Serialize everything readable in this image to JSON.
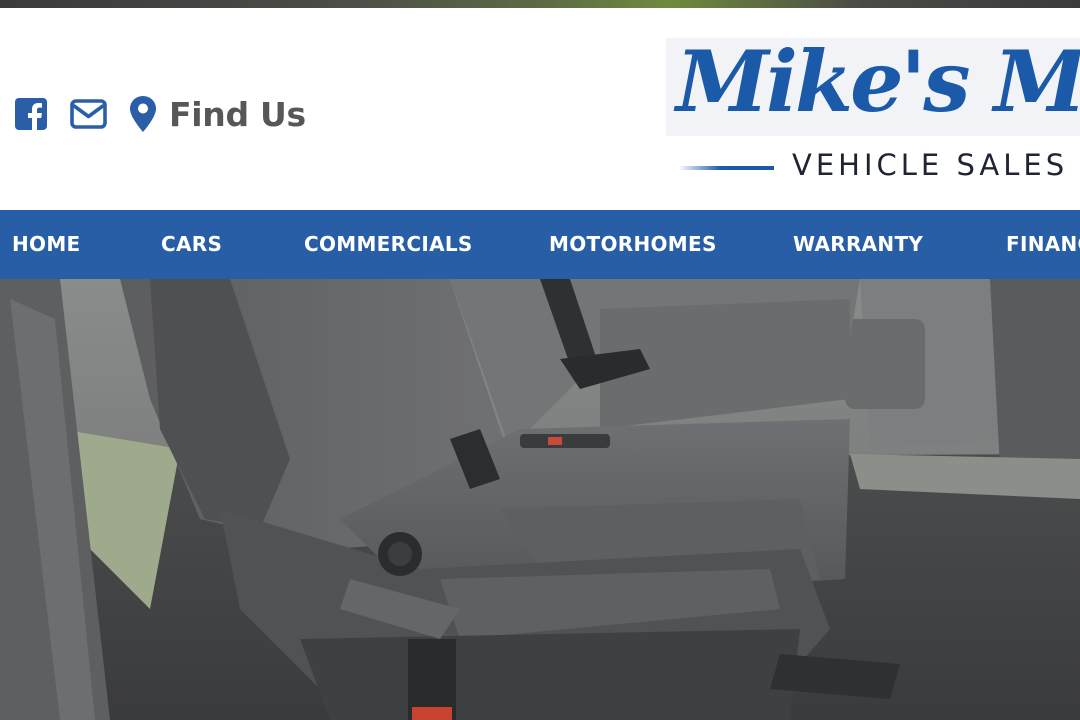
{
  "header": {
    "social": [
      {
        "icon": "facebook-square-icon"
      },
      {
        "icon": "envelope-icon"
      },
      {
        "icon": "map-marker-icon"
      }
    ],
    "find_us_label": "Find Us",
    "logo": {
      "script_text": "Mike's Motors",
      "tagline": "VEHICLE SALES"
    }
  },
  "nav": {
    "items": [
      "HOME",
      "CARS",
      "COMMERCIALS",
      "MOTORHOMES",
      "WARRANTY",
      "FINANCE"
    ]
  },
  "hero": {
    "image": "rear bench seat in van interior"
  },
  "colors": {
    "brand_blue": "#275ea6",
    "logo_blue": "#1a5aa8",
    "icon_blue": "#2a5fa8",
    "text_gray": "#555759",
    "nav_text": "#ffffff"
  }
}
